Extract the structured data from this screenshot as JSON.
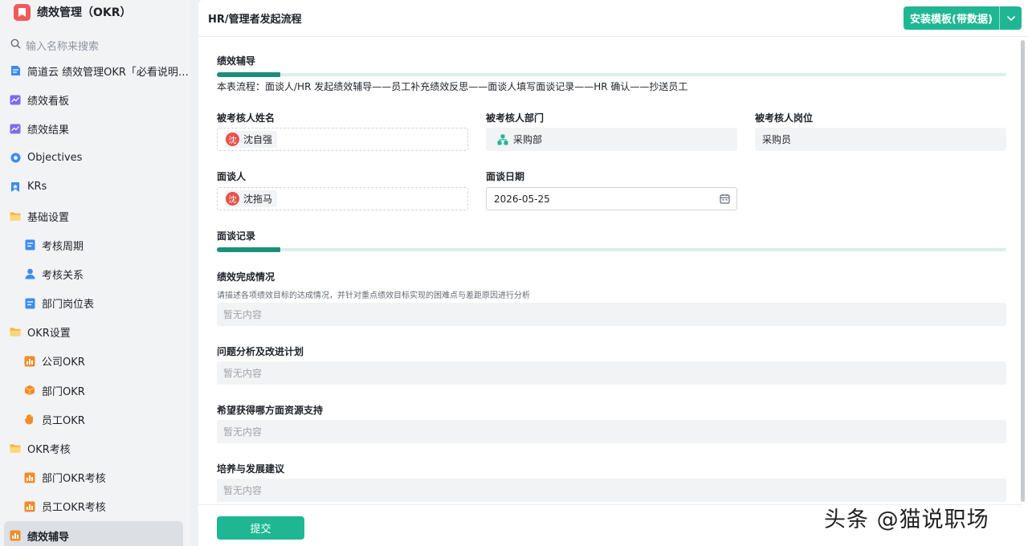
{
  "app": {
    "title": "绩效管理（OKR）"
  },
  "search": {
    "placeholder": "输入名称来搜索"
  },
  "sidebar": {
    "items": [
      {
        "label": "简道云 绩效管理OKR「必看说明…",
        "icon": "doc-icon",
        "color": "#3d8bf2",
        "sub": false,
        "active": false
      },
      {
        "label": "绩效看板",
        "icon": "dashboard-icon",
        "color": "#7b6cf0",
        "sub": false,
        "active": false
      },
      {
        "label": "绩效结果",
        "icon": "dashboard-icon",
        "color": "#7b6cf0",
        "sub": false,
        "active": false
      },
      {
        "label": "Objectives",
        "icon": "target-icon",
        "color": "#3d8bf2",
        "sub": false,
        "active": false
      },
      {
        "label": "KRs",
        "icon": "bookmark-icon",
        "color": "#3d8bf2",
        "sub": false,
        "active": false
      },
      {
        "label": "基础设置",
        "icon": "folder-icon",
        "color": "#f5b53f",
        "sub": false,
        "active": false
      },
      {
        "label": "考核周期",
        "icon": "form-icon",
        "color": "#3d8bf2",
        "sub": true,
        "active": false
      },
      {
        "label": "考核关系",
        "icon": "user-icon",
        "color": "#3d8bf2",
        "sub": true,
        "active": false
      },
      {
        "label": "部门岗位表",
        "icon": "form-icon",
        "color": "#3d8bf2",
        "sub": true,
        "active": false
      },
      {
        "label": "OKR设置",
        "icon": "folder-icon",
        "color": "#f5b53f",
        "sub": false,
        "active": false
      },
      {
        "label": "公司OKR",
        "icon": "flow-icon",
        "color": "#f28c28",
        "sub": true,
        "active": false
      },
      {
        "label": "部门OKR",
        "icon": "box-icon",
        "color": "#f28c28",
        "sub": true,
        "active": false
      },
      {
        "label": "员工OKR",
        "icon": "hand-icon",
        "color": "#f28c28",
        "sub": true,
        "active": false
      },
      {
        "label": "OKR考核",
        "icon": "folder-icon",
        "color": "#f5b53f",
        "sub": false,
        "active": false
      },
      {
        "label": "部门OKR考核",
        "icon": "flow-icon",
        "color": "#f28c28",
        "sub": true,
        "active": false
      },
      {
        "label": "员工OKR考核",
        "icon": "flow-icon",
        "color": "#f28c28",
        "sub": true,
        "active": false
      },
      {
        "label": "绩效辅导",
        "icon": "flow-icon",
        "color": "#f28c28",
        "sub": false,
        "active": true
      }
    ]
  },
  "header": {
    "title": "HR/管理者发起流程",
    "install_label": "安装模板(带数据)"
  },
  "form": {
    "section1_title": "绩效辅导",
    "flow_text": "本表流程：面谈人/HR 发起绩效辅导——员工补充绩效反思——面谈人填写面谈记录——HR 确认——抄送员工",
    "employee_name_label": "被考核人姓名",
    "employee_name": "沈自强",
    "employee_avatar": "沈",
    "department_label": "被考核人部门",
    "department": "采购部",
    "position_label": "被考核人岗位",
    "position": "采购员",
    "interviewer_label": "面谈人",
    "interviewer": "沈拖马",
    "interviewer_avatar": "沈",
    "date_label": "面谈日期",
    "date": "2026-05-25",
    "section2_title": "面谈记录",
    "records": [
      {
        "label": "绩效完成情况",
        "hint": "请描述各项绩效目标的达成情况，并针对重点绩效目标实现的困难点与差距原因进行分析",
        "value": "暂无内容"
      },
      {
        "label": "问题分析及改进计划",
        "hint": "",
        "value": "暂无内容"
      },
      {
        "label": "希望获得哪方面资源支持",
        "hint": "",
        "value": "暂无内容"
      },
      {
        "label": "培养与发展建议",
        "hint": "",
        "value": "暂无内容"
      }
    ],
    "submit_label": "提交"
  },
  "watermark": "头条 @猫说职场",
  "colors": {
    "accent": "#1fb793",
    "section_bar": "#1c8f7a",
    "avatar": "#e5534b"
  }
}
